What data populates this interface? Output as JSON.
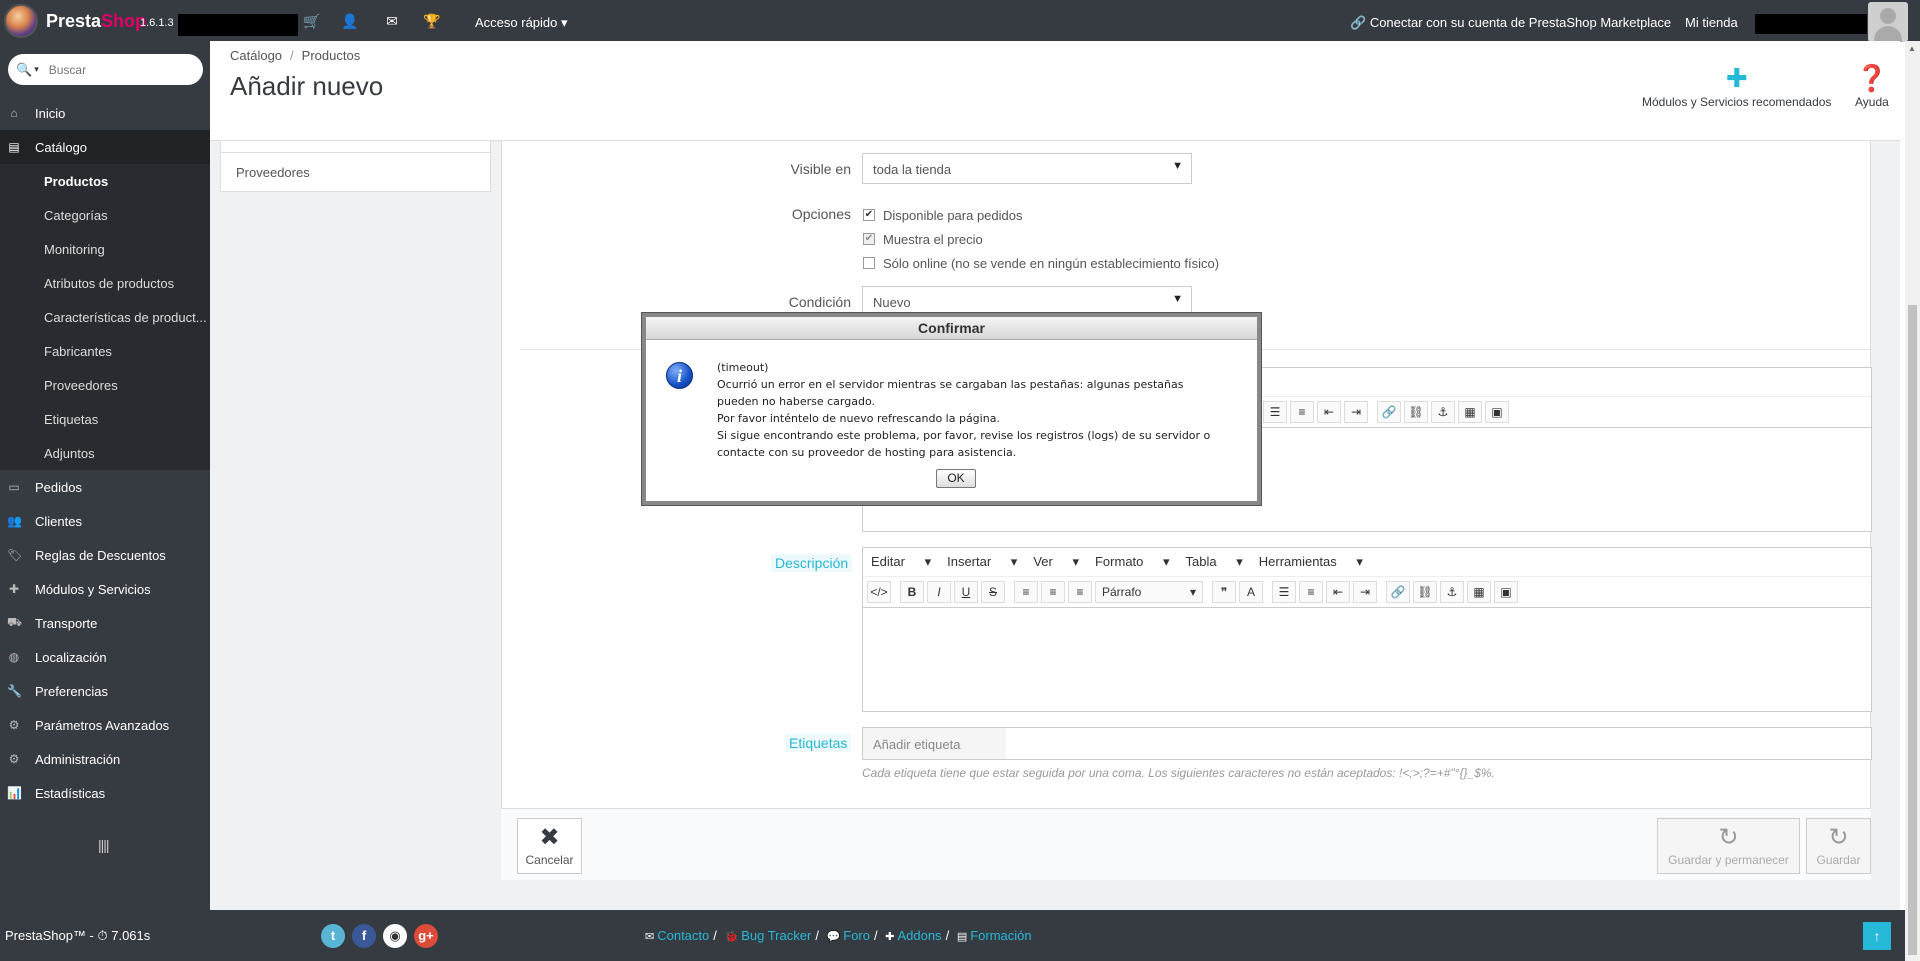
{
  "topbar": {
    "brand_presta": "Presta",
    "brand_shop": "Shop",
    "version": "1.6.1.3",
    "quick_access": "Acceso rápido",
    "marketplace": "Conectar con su cuenta de PrestaShop Marketplace",
    "my_store": "Mi tienda"
  },
  "search": {
    "placeholder": "Buscar"
  },
  "sidebar": {
    "items": [
      {
        "label": "Inicio",
        "icon": "home-icon"
      },
      {
        "label": "Catálogo",
        "icon": "book-icon"
      },
      {
        "label": "Pedidos",
        "icon": "credit-card-icon"
      },
      {
        "label": "Clientes",
        "icon": "users-icon"
      },
      {
        "label": "Reglas de Descuentos",
        "icon": "tag-icon"
      },
      {
        "label": "Módulos y Servicios",
        "icon": "puzzle-icon"
      },
      {
        "label": "Transporte",
        "icon": "truck-icon"
      },
      {
        "label": "Localización",
        "icon": "globe-icon"
      },
      {
        "label": "Preferencias",
        "icon": "wrench-icon"
      },
      {
        "label": "Parámetros Avanzados",
        "icon": "cogs-icon"
      },
      {
        "label": "Administración",
        "icon": "cog-icon"
      },
      {
        "label": "Estadísticas",
        "icon": "bar-chart-icon"
      }
    ],
    "catalog_sub": [
      "Productos",
      "Categorías",
      "Monitoring",
      "Atributos de productos",
      "Características de product...",
      "Fabricantes",
      "Proveedores",
      "Etiquetas",
      "Adjuntos"
    ]
  },
  "header": {
    "breadcrumb": [
      "Catálogo",
      "Productos"
    ],
    "title": "Añadir nuevo",
    "modules_button": "Módulos y Servicios recomendados",
    "help_button": "Ayuda"
  },
  "left_panel": {
    "label": "Proveedores"
  },
  "form": {
    "visible_label": "Visible en",
    "visible_value": "toda la tienda",
    "options_label": "Opciones",
    "options": [
      {
        "label": "Disponible para pedidos",
        "checked": true
      },
      {
        "label": "Muestra el precio",
        "checked": true
      },
      {
        "label": "Sólo online (no se vende en ningún establecimiento físico)",
        "checked": false
      }
    ],
    "condition_label": "Condición",
    "condition_value": "Nuevo",
    "description_label": "Descripción",
    "tags_label": "Etiquetas",
    "tags_placeholder": "Añadir etiqueta",
    "tags_help": "Cada etiqueta tiene que estar seguida por una coma. Los siguientes caracteres no están aceptados: !<;>;?=+#\"°{}_$%."
  },
  "editor": {
    "menu": [
      "Editar",
      "Insertar",
      "Ver",
      "Formato",
      "Tabla",
      "Herramientas"
    ],
    "format_select": "Párrafo"
  },
  "actions": {
    "cancel": "Cancelar",
    "save_stay": "Guardar y permanecer",
    "save": "Guardar"
  },
  "modal": {
    "title": "Confirmar",
    "line1": "(timeout)",
    "line2": "Ocurrió un error en el servidor mientras se cargaban las pestañas: algunas pestañas pueden no haberse cargado.",
    "line3": "Por favor inténtelo de nuevo refrescando la página.",
    "line4": "Si sigue encontrando este problema, por favor, revise los registros (logs) de su servidor o contacte con su proveedor de hosting para asistencia.",
    "ok": "OK"
  },
  "footer": {
    "copyright": "PrestaShop™ - ⏱ 7.061s",
    "links": [
      "Contacto",
      "Bug Tracker",
      "Foro",
      "Addons",
      "Formación"
    ]
  },
  "colors": {
    "accent": "#25b9d7",
    "dark": "#363a41",
    "brand_pink": "#df0067"
  }
}
